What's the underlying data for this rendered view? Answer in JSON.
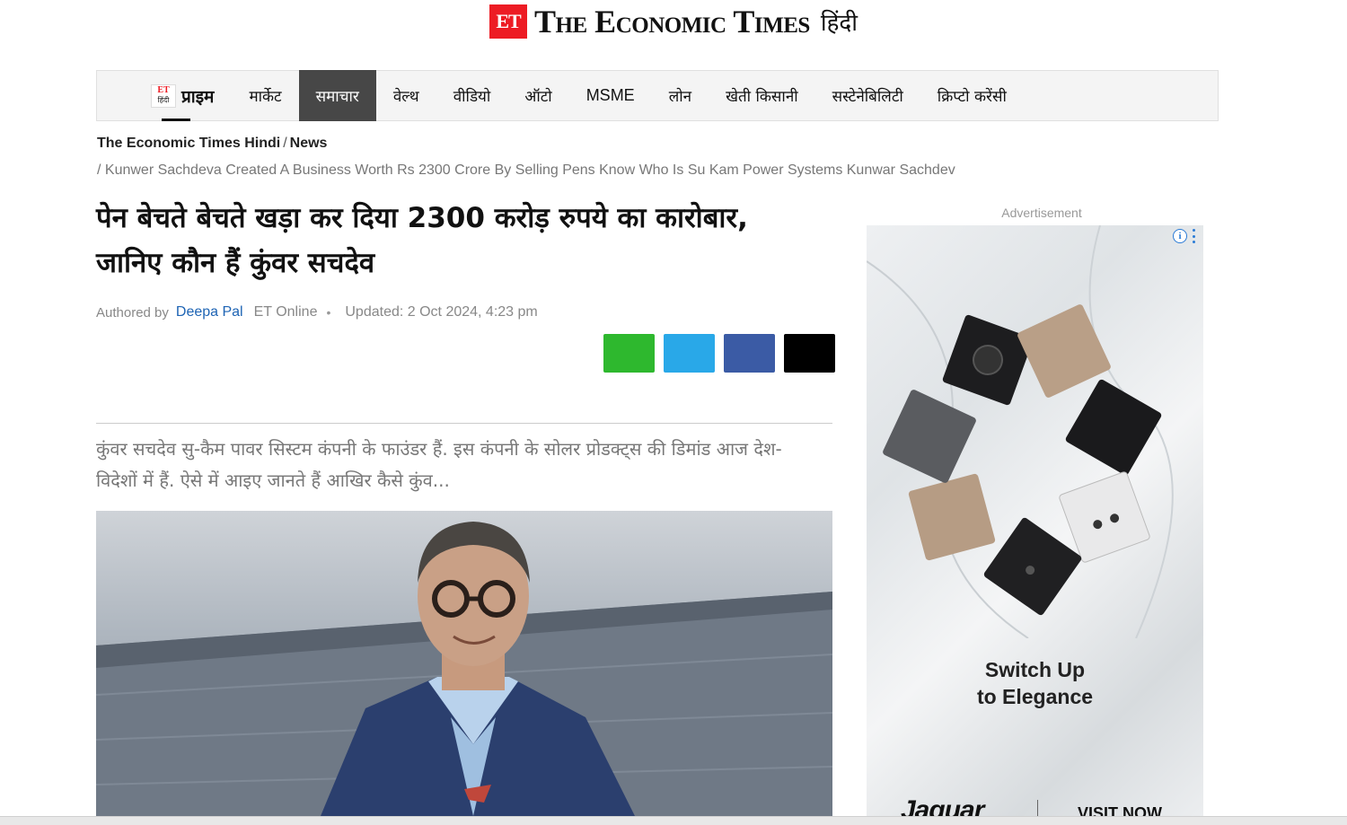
{
  "masthead": {
    "logo": "ET",
    "title": "The Economic Times",
    "lang": "हिंदी"
  },
  "nav": {
    "prime_logo_top": "ET",
    "prime_logo_bottom": "हिंदी",
    "prime_label": "प्राइम",
    "items": [
      {
        "label": "मार्केट"
      },
      {
        "label": "समाचार"
      },
      {
        "label": "वेल्थ"
      },
      {
        "label": "वीडियो"
      },
      {
        "label": "ऑटो"
      },
      {
        "label": "MSME"
      },
      {
        "label": "लोन"
      },
      {
        "label": "खेती किसानी"
      },
      {
        "label": "सस्टेनेबिलिटी"
      },
      {
        "label": "क्रिप्टो करेंसी"
      }
    ],
    "active_index": 1
  },
  "breadcrumb": {
    "home": "The Economic Times Hindi",
    "sep": "/",
    "section": "News",
    "page": "/ Kunwer Sachdeva Created A Business Worth Rs 2300 Crore By Selling Pens Know Who Is Su Kam Power Systems Kunwar Sachdev"
  },
  "article": {
    "headline": "पेन बेचते बेचते खड़ा कर दिया 2300 करोड़ रुपये का कारोबार, जानिए कौन हैं कुंवर सचदेव",
    "authored_by": "Authored by",
    "author": "Deepa Pal",
    "org": "ET Online",
    "dot": "•",
    "updated": "Updated: 2 Oct 2024, 4:23 pm",
    "summary": "कुंवर सचदेव सु-कैम पावर सिस्टम कंपनी के फाउंडर हैं. इस कंपनी के सोलर प्रोडक्ट्स की डिमांड आज देश-विदेशों में हैं. ऐसे में आइए जानते हैं आखिर कैसे कुंव..."
  },
  "share": {
    "buttons": [
      {
        "name": "whatsapp",
        "color": "#2eb82e"
      },
      {
        "name": "twitter",
        "color": "#29a8e8"
      },
      {
        "name": "facebook",
        "color": "#3b5ba5"
      },
      {
        "name": "email",
        "color": "#000000"
      }
    ]
  },
  "ad": {
    "label": "Advertisement",
    "info": "i",
    "tagline_1": "Switch Up",
    "tagline_2": "to Elegance",
    "brand": "Jaquar",
    "cta": "VISIT NOW"
  }
}
